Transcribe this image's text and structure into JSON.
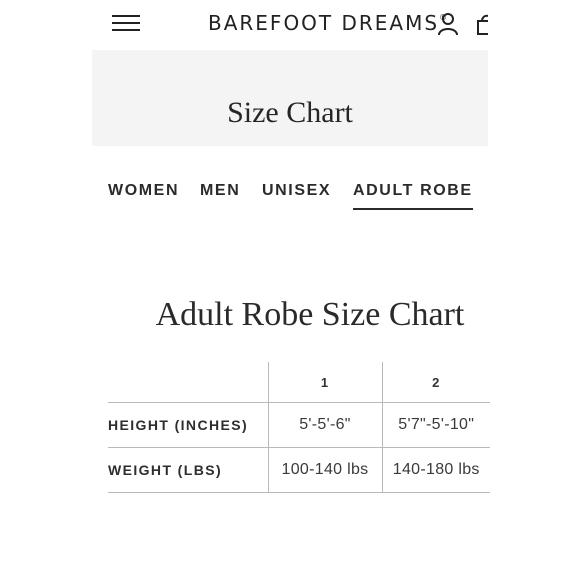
{
  "header": {
    "brand": "BAREFOOT DREAMS",
    "brand_mark": "®",
    "icons": [
      "menu-icon",
      "account-icon",
      "cart-icon"
    ]
  },
  "hero": {
    "title": "Size Chart"
  },
  "tabs": [
    {
      "label": "WOMEN",
      "active": false
    },
    {
      "label": "MEN",
      "active": false
    },
    {
      "label": "UNISEX",
      "active": false
    },
    {
      "label": "ADULT ROBE",
      "active": true
    }
  ],
  "section": {
    "title": "Adult Robe Size Chart"
  },
  "table": {
    "columns": [
      "",
      "1",
      "2"
    ],
    "rows": [
      {
        "label": "HEIGHT (INCHES)",
        "values": [
          "5'-5'-6\"",
          "5'7\"-5'-10\""
        ]
      },
      {
        "label": "WEIGHT (LBS)",
        "values": [
          "100-140 lbs",
          "140-180 lbs"
        ]
      }
    ]
  }
}
